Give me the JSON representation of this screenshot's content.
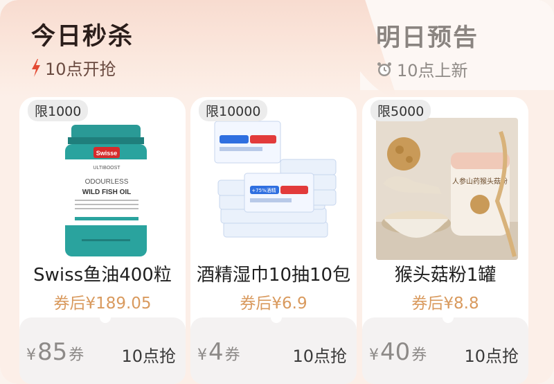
{
  "tabs": {
    "today": {
      "title": "今日秒杀",
      "subtitle": "10点开抢"
    },
    "tomorrow": {
      "title": "明日预告",
      "subtitle": "10点上新"
    }
  },
  "products": [
    {
      "limit": "限1000",
      "name": "Swiss鱼油400粒",
      "price_after_coupon": "券后¥189.05",
      "coupon_currency": "¥",
      "coupon_amount": "85",
      "coupon_unit": "券",
      "grab_time": "10点抢",
      "image_text": {
        "brand": "Swisse",
        "line1": "ULTIBOOST",
        "line2": "ODOURLESS",
        "line3": "WILD FISH OIL"
      }
    },
    {
      "limit": "限10000",
      "name": "酒精湿巾10抽10包",
      "price_after_coupon": "券后¥6.9",
      "coupon_currency": "¥",
      "coupon_amount": "4",
      "coupon_unit": "券",
      "grab_time": "10点抢",
      "image_text": {
        "label": "+75%酒精"
      }
    },
    {
      "limit": "限5000",
      "name": "猴头菇粉1罐",
      "price_after_coupon": "券后¥8.8",
      "coupon_currency": "¥",
      "coupon_amount": "40",
      "coupon_unit": "券",
      "grab_time": "10点抢",
      "image_text": {
        "label": "人参山药猴头菇粉"
      }
    }
  ],
  "colors": {
    "accent_bolt": "#e34a33",
    "price": "#d99a5e",
    "tab_active_bg": "#f8dcd0",
    "coupon_bg": "#f4f2f2"
  },
  "icons": {
    "today": "lightning-icon",
    "tomorrow": "alarm-clock-icon"
  }
}
